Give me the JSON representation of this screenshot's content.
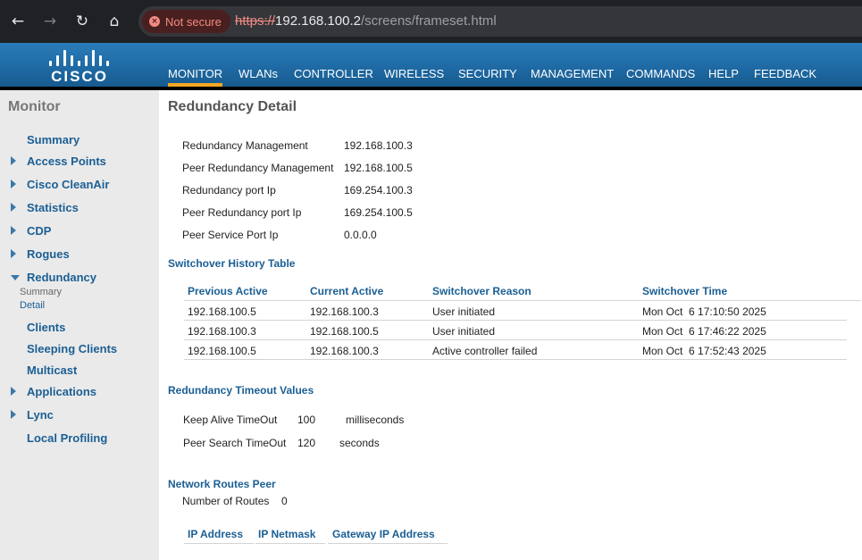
{
  "browser": {
    "security_label": "Not secure",
    "url_proto": "https://",
    "url_host": "192.168.100.2",
    "url_path": "/screens/frameset.html"
  },
  "brand": {
    "logo_text": "CISCO"
  },
  "menu": [
    "MONITOR",
    "WLANs",
    "CONTROLLER",
    "WIRELESS",
    "SECURITY",
    "MANAGEMENT",
    "COMMANDS",
    "HELP",
    "FEEDBACK"
  ],
  "sidebar": {
    "title": "Monitor",
    "items": [
      "Summary",
      "Access Points",
      "Cisco CleanAir",
      "Statistics",
      "CDP",
      "Rogues",
      "Redundancy",
      "Clients",
      "Sleeping Clients",
      "Multicast",
      "Applications",
      "Lync",
      "Local Profiling"
    ],
    "redundancy_subs": [
      "Summary",
      "Detail"
    ]
  },
  "content": {
    "title": "Redundancy Detail",
    "info": [
      {
        "label": "Redundancy Management",
        "value": "192.168.100.3"
      },
      {
        "label": "Peer Redundancy Management",
        "value": "192.168.100.5"
      },
      {
        "label": "Redundancy port Ip",
        "value": "169.254.100.3"
      },
      {
        "label": "Peer Redundancy port Ip",
        "value": "169.254.100.5"
      },
      {
        "label": "Peer Service Port Ip",
        "value": "0.0.0.0"
      }
    ],
    "history": {
      "title": "Switchover History Table",
      "headers": [
        "Previous Active",
        "Current Active",
        "Switchover Reason",
        "Switchover Time"
      ],
      "rows": [
        [
          "192.168.100.5",
          "192.168.100.3",
          "User initiated",
          "Mon Oct  6 17:10:50 2025"
        ],
        [
          "192.168.100.3",
          "192.168.100.5",
          "User initiated",
          "Mon Oct  6 17:46:22 2025"
        ],
        [
          "192.168.100.5",
          "192.168.100.3",
          "Active controller failed",
          "Mon Oct  6 17:52:43 2025"
        ]
      ]
    },
    "timeouts": {
      "title": "Redundancy Timeout Values",
      "keep_alive_label": "Keep Alive TimeOut",
      "keep_alive_value": "100",
      "keep_alive_unit": "milliseconds",
      "peer_search_label": "Peer Search TimeOut",
      "peer_search_value": "120",
      "peer_search_unit": "seconds"
    },
    "routes": {
      "title": "Network Routes Peer",
      "count_label": "Number of Routes",
      "count_value": "0",
      "headers": [
        "IP Address",
        "IP Netmask",
        "Gateway IP Address"
      ]
    }
  }
}
